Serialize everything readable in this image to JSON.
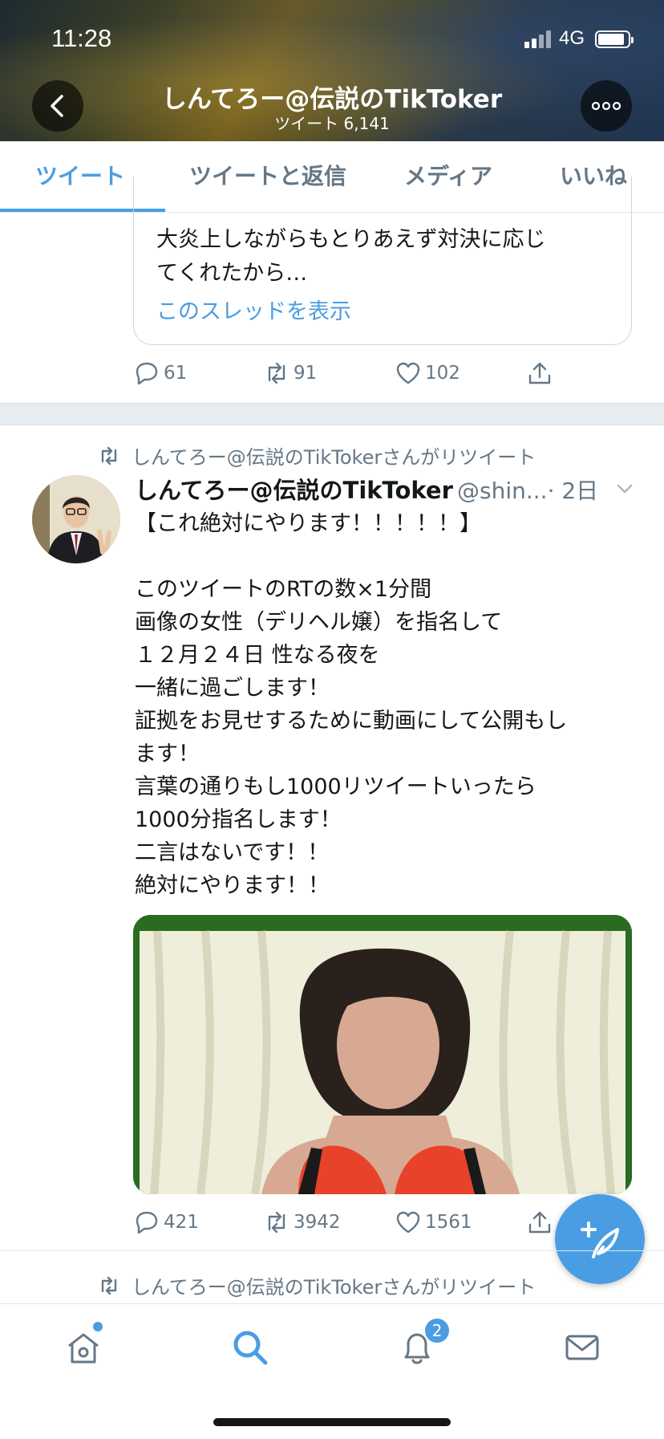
{
  "status_bar": {
    "time": "11:28",
    "network": "4G"
  },
  "header": {
    "title": "しんてろー@伝説のTikToker",
    "subtitle": "ツイート 6,141"
  },
  "tabs": [
    {
      "label": "ツイート",
      "active": true
    },
    {
      "label": "ツイートと返信",
      "active": false
    },
    {
      "label": "メディア",
      "active": false
    },
    {
      "label": "いいね",
      "active": false
    }
  ],
  "prev_tweet": {
    "quote_lines": [
      "大炎上しながらもとりあえず対決に応じ",
      "てくれたから…"
    ],
    "thread_link": "このスレッドを表示",
    "replies": "61",
    "retweets": "91",
    "likes": "102"
  },
  "tweet": {
    "retweet_label": "しんてろー@伝説のTikTokerさんがリツイート",
    "name": "しんてろー@伝説のTikToker",
    "handle": "@shin...",
    "time": "· 2日",
    "lines": [
      "【これ絶対にやります！！！！！】",
      "",
      "このツイートのRTの数×1分間",
      "画像の女性（デリヘル嬢）を指名して",
      "１２月２４日 性なる夜を",
      "一緒に過ごします！",
      "証拠をお見せするために動画にして公開もし",
      "ます！",
      "言葉の通りもし1000リツイートいったら",
      "1000分指名します！",
      "二言はないです！！",
      "絶対にやります！！"
    ],
    "replies": "421",
    "retweets": "3942",
    "likes": "1561"
  },
  "next_tweet": {
    "retweet_label": "しんてろー@伝説のTikTokerさんがリツイート"
  },
  "bottom_nav": {
    "items": [
      "home-icon",
      "search-icon",
      "notifications-icon",
      "messages-icon"
    ],
    "notifications_badge": "2"
  },
  "colors": {
    "accent": "#4a9de3",
    "text": "#14171a",
    "muted": "#657786"
  }
}
